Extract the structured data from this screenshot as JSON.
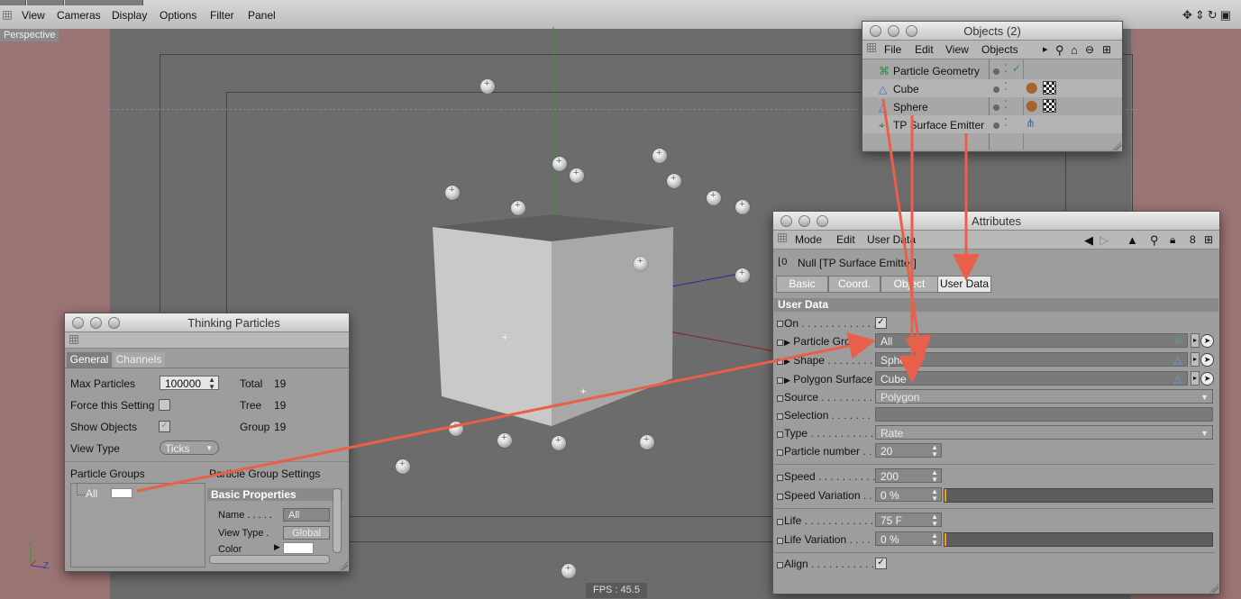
{
  "menubar": {
    "items": [
      "View",
      "Cameras",
      "Display",
      "Options",
      "Filter",
      "Panel"
    ]
  },
  "viewport": {
    "label": "Perspective",
    "fps": "FPS : 45.5",
    "axis_y": "Y",
    "axis_z": "Z"
  },
  "objects_panel": {
    "title": "Objects (2)",
    "menu": [
      "File",
      "Edit",
      "View",
      "Objects"
    ],
    "items": [
      {
        "name": "Particle Geometry",
        "icon": "particle-geometry-icon"
      },
      {
        "name": "Cube",
        "icon": "cube-icon"
      },
      {
        "name": "Sphere",
        "icon": "sphere-icon"
      },
      {
        "name": "TP Surface Emitter",
        "icon": "surface-emitter-icon"
      }
    ]
  },
  "attributes_panel": {
    "title": "Attributes",
    "menu": [
      "Mode",
      "Edit",
      "User Data"
    ],
    "object_name": "Null [TP Surface Emitter]",
    "tabs": [
      "Basic",
      "Coord.",
      "Object",
      "User Data"
    ],
    "active_tab": "User Data",
    "section": "User Data",
    "fields": {
      "on_label": "On",
      "particle_group_label": "Particle Group",
      "particle_group_value": "All",
      "shape_label": "Shape",
      "shape_value": "Sphere",
      "polygon_surface_label": "Polygon Surface",
      "polygon_surface_value": "Cube",
      "source_label": "Source",
      "source_value": "Polygon",
      "selection_label": "Selection",
      "selection_value": "",
      "type_label": "Type",
      "type_value": "Rate",
      "particle_number_label": "Particle number",
      "particle_number_value": "20",
      "speed_label": "Speed",
      "speed_value": "200",
      "speed_variation_label": "Speed Variation",
      "speed_variation_value": "0 %",
      "life_label": "Life",
      "life_value": "75 F",
      "life_variation_label": "Life Variation",
      "life_variation_value": "0 %",
      "align_label": "Align"
    }
  },
  "tp_panel": {
    "title": "Thinking Particles",
    "tabs": [
      "General",
      "Channels"
    ],
    "active_tab": "General",
    "max_particles_label": "Max Particles",
    "max_particles_value": "100000",
    "total_label": "Total",
    "total_value": "19",
    "force_setting_label": "Force this Setting",
    "tree_label": "Tree",
    "tree_value": "19",
    "show_objects_label": "Show Objects",
    "group_label": "Group",
    "group_value": "19",
    "view_type_label": "View Type",
    "view_type_value": "Ticks",
    "particle_groups_label": "Particle Groups",
    "group_settings_label": "Particle Group Settings",
    "group_item": "All",
    "basic_properties": "Basic Properties",
    "name_label": "Name",
    "name_value": "All",
    "view_type2_label": "View Type",
    "view_type2_value": "Global",
    "color_label": "Color"
  },
  "colors": {
    "arrow": "#e8604a",
    "viewport_bg": "#6c6c6c",
    "safe_frame": "#9b7474"
  }
}
